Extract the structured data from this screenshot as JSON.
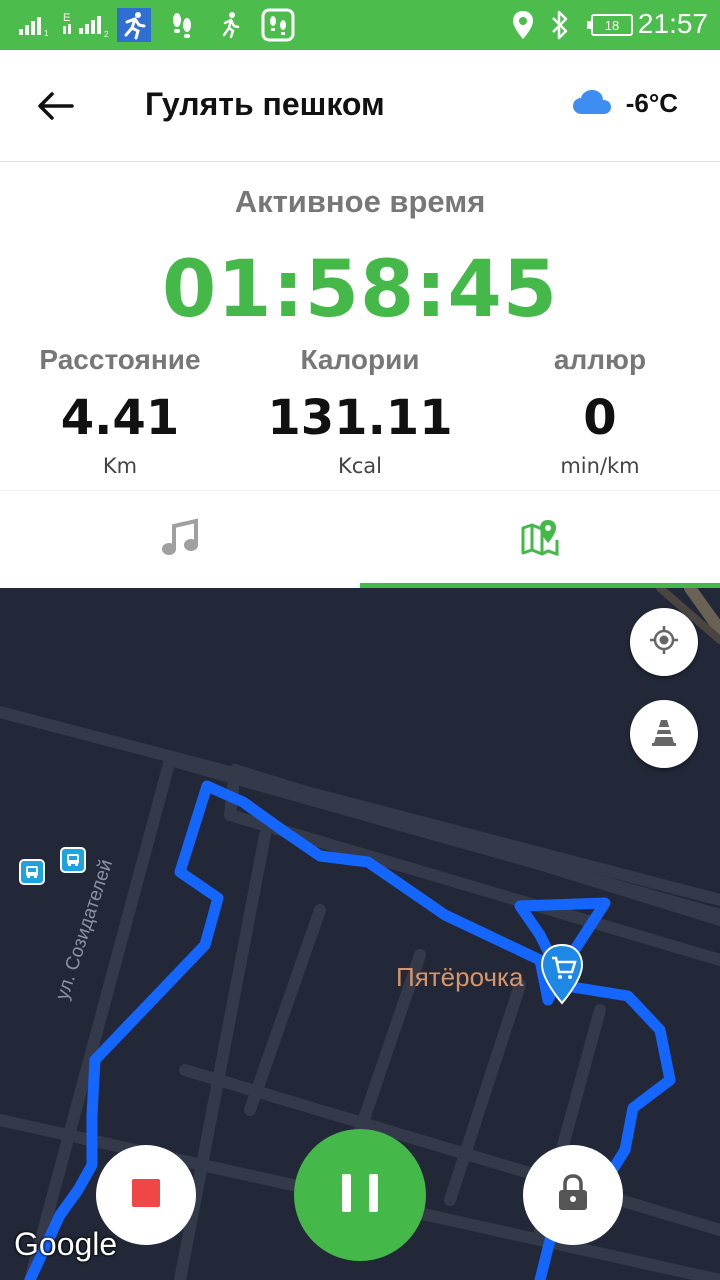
{
  "status_bar": {
    "time": "21:57",
    "battery": "18",
    "icons": [
      "signal-icon",
      "signal-e-icon",
      "running-app-icon",
      "footsteps-icon",
      "walking-person-icon",
      "footprints-app-icon",
      "location-pin-icon",
      "bluetooth-icon",
      "battery-icon"
    ]
  },
  "header": {
    "title": "Гулять пешком",
    "temperature": "-6°C",
    "weather_icon": "cloud-icon"
  },
  "workout": {
    "active_label": "Активное время",
    "timer": "01:58:45",
    "stats": [
      {
        "label": "Расстояние",
        "value": "4.41",
        "unit": "Km"
      },
      {
        "label": "Калории",
        "value": "131.11",
        "unit": "Kcal"
      },
      {
        "label": "аллюр",
        "value": "0",
        "unit": "min/km"
      }
    ]
  },
  "tabs": [
    {
      "icon": "music-note-icon",
      "active": false
    },
    {
      "icon": "map-pin-icon",
      "active": true
    }
  ],
  "map": {
    "street_label": "ул. Созидателей",
    "poi_label": "Пятёрочка",
    "attribution": "Google",
    "colors": {
      "background": "#222838",
      "route": "#1565ff",
      "poi_text": "#d9956a"
    }
  },
  "controls": [
    "stop-button",
    "pause-button",
    "lock-button"
  ],
  "colors": {
    "accent": "#45b84a",
    "status_bar": "#4cbc4c"
  }
}
